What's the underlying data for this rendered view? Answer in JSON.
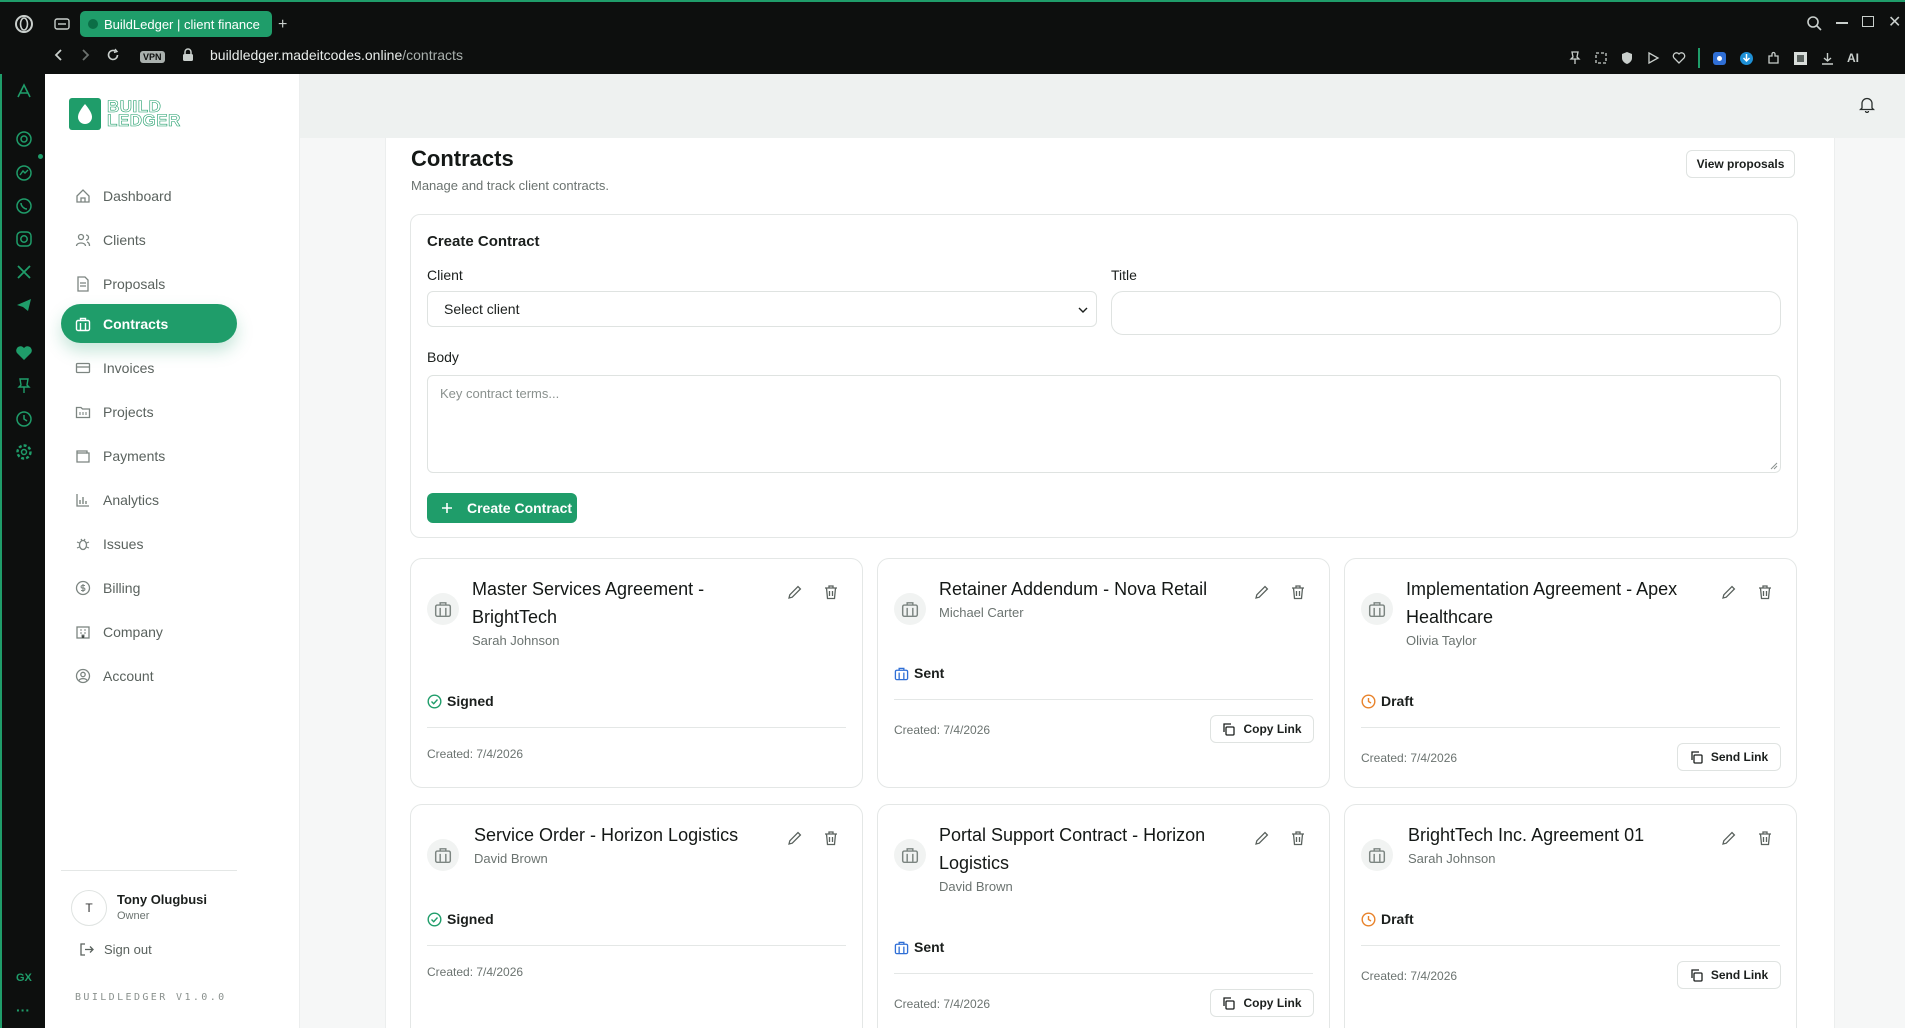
{
  "browser": {
    "tab_title": "BuildLedger | client finance",
    "vpn_label": "VPN",
    "url_domain": "buildledger.madeitcodes.online",
    "url_path": "/contracts",
    "ai_label": "AI",
    "gx_label": "GX"
  },
  "brand": {
    "line1": "BUILD",
    "line2": "LEDGER",
    "accent": "#1f9d6a"
  },
  "sidebar": {
    "items": [
      {
        "label": "Dashboard",
        "icon": "home-icon"
      },
      {
        "label": "Clients",
        "icon": "users-icon"
      },
      {
        "label": "Proposals",
        "icon": "file-icon"
      },
      {
        "label": "Contracts",
        "icon": "briefcase-icon",
        "active": true
      },
      {
        "label": "Invoices",
        "icon": "card-icon"
      },
      {
        "label": "Projects",
        "icon": "folder-icon"
      },
      {
        "label": "Payments",
        "icon": "wallet-icon"
      },
      {
        "label": "Analytics",
        "icon": "chart-icon"
      },
      {
        "label": "Issues",
        "icon": "bug-icon"
      },
      {
        "label": "Billing",
        "icon": "dollar-icon"
      },
      {
        "label": "Company",
        "icon": "building-icon"
      },
      {
        "label": "Account",
        "icon": "user-circle-icon"
      }
    ],
    "user": {
      "initial": "T",
      "name": "Tony Olugbusi",
      "role": "Owner"
    },
    "sign_out": "Sign out",
    "version": "BUILDLEDGER V1.0.0"
  },
  "page": {
    "title": "Contracts",
    "subtitle": "Manage and track client contracts.",
    "view_proposals": "View proposals"
  },
  "form": {
    "heading": "Create Contract",
    "client_label": "Client",
    "client_value": "Select client",
    "title_label": "Title",
    "title_value": "",
    "body_label": "Body",
    "body_placeholder": "Key contract terms...",
    "submit": "Create Contract"
  },
  "contracts": [
    {
      "title_l1": "Master Services Agreement -",
      "title_l2": "BrightTech",
      "client": "Sarah Johnson",
      "status": "Signed",
      "created": "Created: 7/4/2026",
      "action": ""
    },
    {
      "title_l1": "Retainer Addendum - Nova Retail",
      "title_l2": "",
      "client": "Michael Carter",
      "status": "Sent",
      "created": "Created: 7/4/2026",
      "action": "Copy Link"
    },
    {
      "title_l1": "Implementation Agreement - Apex",
      "title_l2": "Healthcare",
      "client": "Olivia Taylor",
      "status": "Draft",
      "created": "Created: 7/4/2026",
      "action": "Send Link"
    },
    {
      "title_l1": "Service Order - Horizon Logistics",
      "title_l2": "",
      "client": "David Brown",
      "status": "Signed",
      "created": "Created: 7/4/2026",
      "action": ""
    },
    {
      "title_l1": "Portal Support Contract - Horizon",
      "title_l2": "Logistics",
      "client": "David Brown",
      "status": "Sent",
      "created": "Created: 7/4/2026",
      "action": "Copy Link"
    },
    {
      "title_l1": "BrightTech Inc. Agreement 01",
      "title_l2": "",
      "client": "Sarah Johnson",
      "status": "Draft",
      "created": "Created: 7/4/2026",
      "action": "Send Link"
    }
  ],
  "status_colors": {
    "Signed": "#1f9d6a",
    "Sent": "#2f6fd6",
    "Draft": "#e8822a"
  }
}
